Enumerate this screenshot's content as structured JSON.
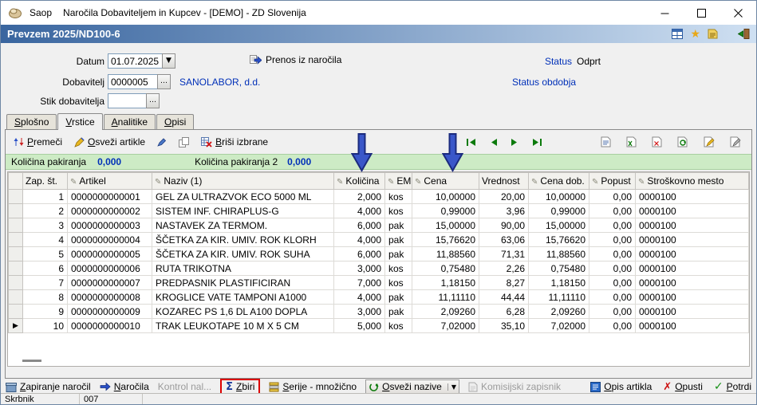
{
  "colors": {
    "hdr-start": "#39659f",
    "hdr-end": "#cfe0f2",
    "link-blue": "#0030b8",
    "value-blue": "#0030b8",
    "green-bar": "#cdebc5",
    "arrow-fill": "#3a57c9",
    "arrow-stroke": "#1b2b7e",
    "annot-red": "#dd0000"
  },
  "icons": {
    "pencil": "✎",
    "dropdown": "▼",
    "ellipsis": "…",
    "star": "★",
    "sigma": "Σ",
    "check": "✓",
    "cross": "✗"
  },
  "titlebar": {
    "app": "Saop",
    "title": "Naročila Dobaviteljem in Kupcev -  [DEMO] - ZD Slovenija"
  },
  "header": {
    "caption": "Prevzem 2025/ND100-6"
  },
  "form": {
    "datum": {
      "label": "Datum",
      "value": "01.07.2025"
    },
    "prenos_label": "Prenos iz naročila",
    "status": {
      "label": "Status",
      "value": "Odprt"
    },
    "status_obdobja": "Status obdobja",
    "dobavitelj": {
      "label": "Dobavitelj",
      "value": "0000005",
      "name": "SANOLABOR, d.d."
    },
    "stik": {
      "label": "Stik dobavitelja",
      "value": ""
    }
  },
  "tabs": [
    {
      "label": "Splošno"
    },
    {
      "label": "Vrstice"
    },
    {
      "label": "Analitike"
    },
    {
      "label": "Opisi"
    }
  ],
  "toolbar": {
    "premeci": "Premeči",
    "osvezi_artikle": "Osveži artikle",
    "brisi_izbrane": "Briši izbrane"
  },
  "info_bar": {
    "label1": "Količina pakiranja",
    "value1": "0,000",
    "label2": "Količina pakiranja 2",
    "value2": "0,000"
  },
  "grid": {
    "columns": [
      "Zap. št.",
      "Artikel",
      "Naziv (1)",
      "Količina",
      "EM",
      "Cena",
      "Vrednost",
      "Cena dob.",
      "Popust",
      "Stroškovno mesto"
    ],
    "rows": [
      {
        "zap": "1",
        "artikel": "0000000000001",
        "naziv": "GEL ZA ULTRAZVOK ECO 5000 ML",
        "kolicina": "2,000",
        "em": "kos",
        "cena": "10,00000",
        "vrednost": "20,00",
        "cena_dob": "10,00000",
        "popust": "0,00",
        "sm": "0000100",
        "marker": ""
      },
      {
        "zap": "2",
        "artikel": "0000000000002",
        "naziv": "SISTEM INF. CHIRAPLUS-G",
        "kolicina": "4,000",
        "em": "kos",
        "cena": "0,99000",
        "vrednost": "3,96",
        "cena_dob": "0,99000",
        "popust": "0,00",
        "sm": "0000100",
        "marker": ""
      },
      {
        "zap": "3",
        "artikel": "0000000000003",
        "naziv": "NASTAVEK ZA TERMOM.",
        "kolicina": "6,000",
        "em": "pak",
        "cena": "15,00000",
        "vrednost": "90,00",
        "cena_dob": "15,00000",
        "popust": "0,00",
        "sm": "0000100",
        "marker": ""
      },
      {
        "zap": "4",
        "artikel": "0000000000004",
        "naziv": "ŠČETKA ZA KIR. UMIV. ROK KLORH",
        "kolicina": "4,000",
        "em": "pak",
        "cena": "15,76620",
        "vrednost": "63,06",
        "cena_dob": "15,76620",
        "popust": "0,00",
        "sm": "0000100",
        "marker": ""
      },
      {
        "zap": "5",
        "artikel": "0000000000005",
        "naziv": "ŠČETKA ZA KIR. UMIV. ROK SUHA",
        "kolicina": "6,000",
        "em": "pak",
        "cena": "11,88560",
        "vrednost": "71,31",
        "cena_dob": "11,88560",
        "popust": "0,00",
        "sm": "0000100",
        "marker": ""
      },
      {
        "zap": "6",
        "artikel": "0000000000006",
        "naziv": "RUTA TRIKOTNA",
        "kolicina": "3,000",
        "em": "kos",
        "cena": "0,75480",
        "vrednost": "2,26",
        "cena_dob": "0,75480",
        "popust": "0,00",
        "sm": "0000100",
        "marker": ""
      },
      {
        "zap": "7",
        "artikel": "0000000000007",
        "naziv": "PREDPASNIK PLASTIFICIRAN",
        "kolicina": "7,000",
        "em": "kos",
        "cena": "1,18150",
        "vrednost": "8,27",
        "cena_dob": "1,18150",
        "popust": "0,00",
        "sm": "0000100",
        "marker": ""
      },
      {
        "zap": "8",
        "artikel": "0000000000008",
        "naziv": "KROGLICE VATE TAMPONI A1000",
        "kolicina": "4,000",
        "em": "pak",
        "cena": "11,11110",
        "vrednost": "44,44",
        "cena_dob": "11,11110",
        "popust": "0,00",
        "sm": "0000100",
        "marker": ""
      },
      {
        "zap": "9",
        "artikel": "0000000000009",
        "naziv": "KOZAREC PS 1,6 DL A100 DOPLA",
        "kolicina": "3,000",
        "em": "pak",
        "cena": "2,09260",
        "vrednost": "6,28",
        "cena_dob": "2,09260",
        "popust": "0,00",
        "sm": "0000100",
        "marker": ""
      },
      {
        "zap": "10",
        "artikel": "0000000000010",
        "naziv": "TRAK LEUKOTAPE 10 M X 5 CM",
        "kolicina": "5,000",
        "em": "kos",
        "cena": "7,02000",
        "vrednost": "35,10",
        "cena_dob": "7,02000",
        "popust": "0,00",
        "sm": "0000100",
        "marker": "▶"
      }
    ]
  },
  "footer": {
    "zapiranje": "Zapiranje naročil",
    "narocila": "Naročila",
    "kontrol": "Kontrol nal...",
    "zbiri": "Zbiri",
    "serije": "Serije - množično",
    "osvezi_nazive": "Osveži nazive",
    "komisijski": "Komisijski zapisnik",
    "opis_artikla": "Opis artikla",
    "opusti": "Opusti",
    "potrdi": "Potrdi"
  },
  "statusbar": {
    "user": "Skrbnik",
    "code": "007"
  }
}
